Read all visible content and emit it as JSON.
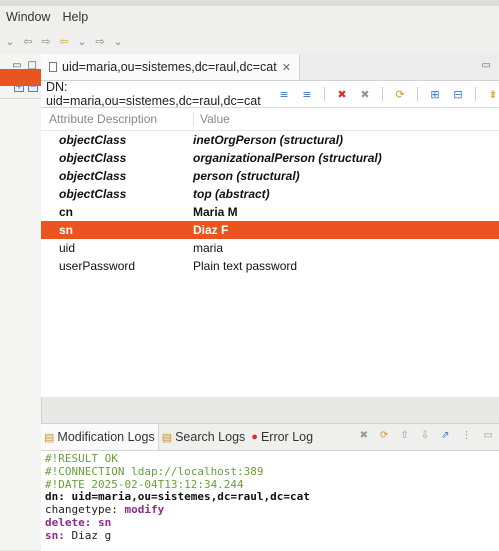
{
  "menubar": {
    "window": "Window",
    "help": "Help"
  },
  "editor": {
    "tab_title": "uid=maria,ou=sistemes,dc=raul,dc=cat",
    "dn": "DN: uid=maria,ou=sistemes,dc=raul,dc=cat",
    "columns": {
      "attribute": "Attribute Description",
      "value": "Value"
    },
    "rows": [
      {
        "attr": "objectClass",
        "value": "inetOrgPerson (structural)"
      },
      {
        "attr": "objectClass",
        "value": "organizationalPerson (structural)"
      },
      {
        "attr": "objectClass",
        "value": "person (structural)"
      },
      {
        "attr": "objectClass",
        "value": "top (abstract)"
      },
      {
        "attr": "cn",
        "value": "Maria M"
      },
      {
        "attr": "sn",
        "value": "Diaz F"
      },
      {
        "attr": "uid",
        "value": "maria"
      },
      {
        "attr": "userPassword",
        "value": "Plain text password"
      }
    ],
    "selected_row": "sn"
  },
  "logs": {
    "tabs": [
      "Modification Logs",
      "Search Logs",
      "Error Log"
    ],
    "lines": {
      "result": "#!RESULT OK",
      "connection": "#!CONNECTION ldap://localhost:389",
      "date": "#!DATE 2025-02-04T13:12:34.244",
      "dn_key": "dn:",
      "dn_val": "uid=maria,ou=sistemes,dc=raul,dc=cat",
      "ct_key": "changetype:",
      "ct_val": "modify",
      "del_key": "delete:",
      "del_val": "sn",
      "sn_key": "sn:",
      "sn_val": "Diaz g"
    }
  },
  "colors": {
    "accent": "#e95420",
    "comment": "#6a9e3a",
    "keyword": "#8b2c8b"
  }
}
